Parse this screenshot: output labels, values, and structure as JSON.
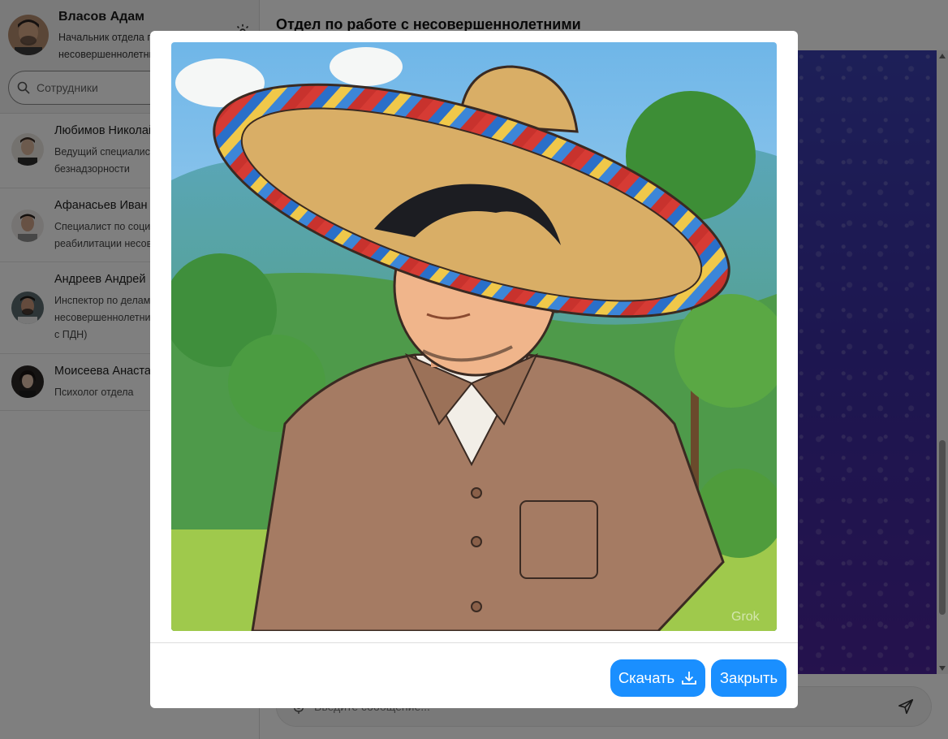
{
  "profile": {
    "name": "Власов Адам",
    "role": "Начальник отдела по работе с несовершеннолетними"
  },
  "search": {
    "placeholder": "Сотрудники"
  },
  "contacts": [
    {
      "name": "Любимов Николай",
      "role": "Ведущий специалист по профилактике безнадзорности"
    },
    {
      "name": "Афанасьев Иван",
      "role": "Специалист по социальной реабилитации несовершеннолетних"
    },
    {
      "name": "Андреев Андрей",
      "role": "Инспектор по делам несовершеннолетних (группа по работе с ПДН)"
    },
    {
      "name": "Моисеева Анастасия",
      "role": "Психолог отдела"
    }
  ],
  "chat": {
    "title": "Отдел по работе с несовершеннолетними",
    "composer_placeholder": "Введите сообщение..."
  },
  "modal": {
    "download_label": "Скачать",
    "close_label": "Закрыть",
    "image_watermark": "Grok"
  },
  "colors": {
    "accent": "#1a8fff",
    "overlay": "rgba(0,0,0,0.5)",
    "wallpaper": "#3b2f9a"
  },
  "icons": [
    "gear-icon",
    "search-icon",
    "download-icon",
    "send-icon",
    "microphone-icon"
  ]
}
